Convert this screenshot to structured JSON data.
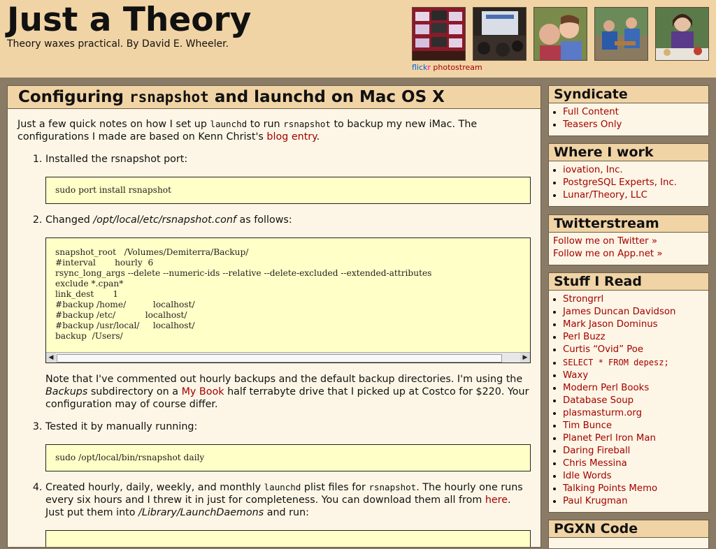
{
  "header": {
    "title": "Just a Theory",
    "tagline": "Theory waxes practical. By David E. Wheeler.",
    "flickr_brand_1": "flick",
    "flickr_brand_2": "r",
    "flickr_suffix": " photostream"
  },
  "post": {
    "title_pre": "Configuring ",
    "title_code": "rsnapshot",
    "title_post": " and launchd on Mac OS X",
    "intro_a": "Just a few quick notes on how I set up ",
    "intro_code1": "launchd",
    "intro_b": " to run ",
    "intro_code2": "rsnapshot",
    "intro_c": " to backup my new iMac. The configurations I made are based on Kenn Christ's ",
    "intro_link": "blog entry",
    "intro_d": ".",
    "step1": "Installed the rsnapshot port:",
    "code1": "sudo port install rsnapshot",
    "step2_a": "Changed ",
    "step2_path": "/opt/local/etc/rsnapshot.conf",
    "step2_b": " as follows:",
    "code2": "snapshot_root   /Volumes/Demiterra/Backup/\n#interval       hourly  6\nrsync_long_args --delete --numeric-ids --relative --delete-excluded --extended-attributes\nexclude *.cpan*\nlink_dest       1\n#backup /home/          localhost/\n#backup /etc/           localhost/\n#backup /usr/local/     localhost/\nbackup  /Users/",
    "note_a": "Note that I've commented out hourly backups and the default backup directories. I'm using the ",
    "note_em": "Backups",
    "note_b": " subdirectory on a ",
    "note_link": "My Book",
    "note_c": " half terrabyte drive that I picked up at Costco for $220. Your configuration may of course differ.",
    "step3": "Tested it by manually running:",
    "code3": "sudo /opt/local/bin/rsnapshot daily",
    "step4_a": "Created hourly, daily, weekly, and monthly ",
    "step4_code1": "launchd",
    "step4_b": " plist files for ",
    "step4_code2": "rsnapshot",
    "step4_c": ". The hourly one runs every six hours and I threw it in just for completeness. You can download them all from ",
    "step4_link": "here",
    "step4_d": ". Just put them into ",
    "step4_path": "/Library/LaunchDaemons",
    "step4_e": " and run:"
  },
  "sidebar": {
    "syndicate": {
      "title": "Syndicate",
      "items": [
        "Full Content",
        "Teasers Only"
      ]
    },
    "work": {
      "title": "Where I work",
      "items": [
        "iovation, Inc.",
        "PostgreSQL Experts, Inc.",
        "Lunar/Theory, LLC"
      ]
    },
    "twitter": {
      "title": "Twitterstream",
      "items": [
        "Follow me on Twitter »",
        "Follow me on App.net »"
      ]
    },
    "reads": {
      "title": "Stuff I Read",
      "items": [
        "Strongrrl",
        "James Duncan Davidson",
        "Mark Jason Dominus",
        "Perl Buzz",
        "Curtis “Ovid” Poe",
        "SELECT * FROM depesz;",
        "Waxy",
        "Modern Perl Books",
        "Database Soup",
        "plasmasturm.org",
        "Tim Bunce",
        "Planet Perl Iron Man",
        "Daring Fireball",
        "Chris Messina",
        "Idle Words",
        "Talking Points Memo",
        "Paul Krugman"
      ]
    },
    "pgxn": {
      "title": "PGXN Code"
    }
  },
  "colors": {
    "header_bg": "#f1d4a5",
    "page_bg": "#8a7b66",
    "link": "#a30000",
    "code_bg": "#ffffc8"
  },
  "icons": {
    "scroll_left": "scroll-left-icon",
    "scroll_right": "scroll-right-icon"
  }
}
